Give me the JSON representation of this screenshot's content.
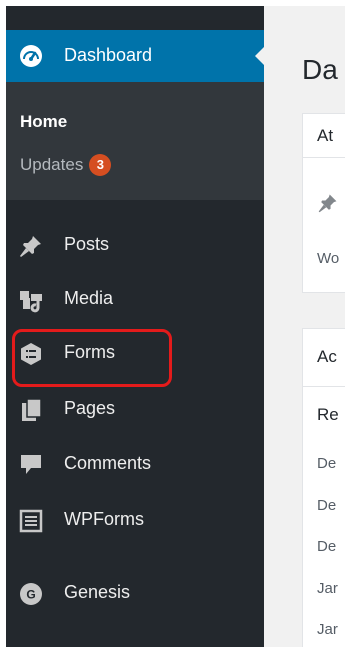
{
  "sidebar": {
    "dashboard": {
      "label": "Dashboard",
      "icon": "dashboard-gauge-icon"
    },
    "submenu": {
      "home": "Home",
      "updates": {
        "label": "Updates",
        "count": "3"
      }
    },
    "items": [
      {
        "id": "posts",
        "label": "Posts",
        "icon": "pushpin-icon"
      },
      {
        "id": "media",
        "label": "Media",
        "icon": "media-icon"
      },
      {
        "id": "forms",
        "label": "Forms",
        "icon": "forms-icon",
        "highlighted": true
      },
      {
        "id": "pages",
        "label": "Pages",
        "icon": "pages-icon"
      },
      {
        "id": "comments",
        "label": "Comments",
        "icon": "comment-icon"
      },
      {
        "id": "wpforms",
        "label": "WPForms",
        "icon": "wpforms-icon"
      },
      {
        "id": "genesis",
        "label": "Genesis",
        "icon": "genesis-icon"
      }
    ]
  },
  "main": {
    "title": "Da",
    "at_a_glance": {
      "title": "At",
      "line": "Wo"
    },
    "activity": {
      "title": "Ac",
      "subtitle": "Re",
      "rows": [
        "De",
        "De",
        "De",
        "Jar",
        "Jar"
      ]
    }
  },
  "colors": {
    "sidebar_bg": "#23282d",
    "submenu_bg": "#32373c",
    "active_blue": "#0073aa",
    "badge_orange": "#d54e21",
    "highlight_red": "#e41b1b"
  }
}
